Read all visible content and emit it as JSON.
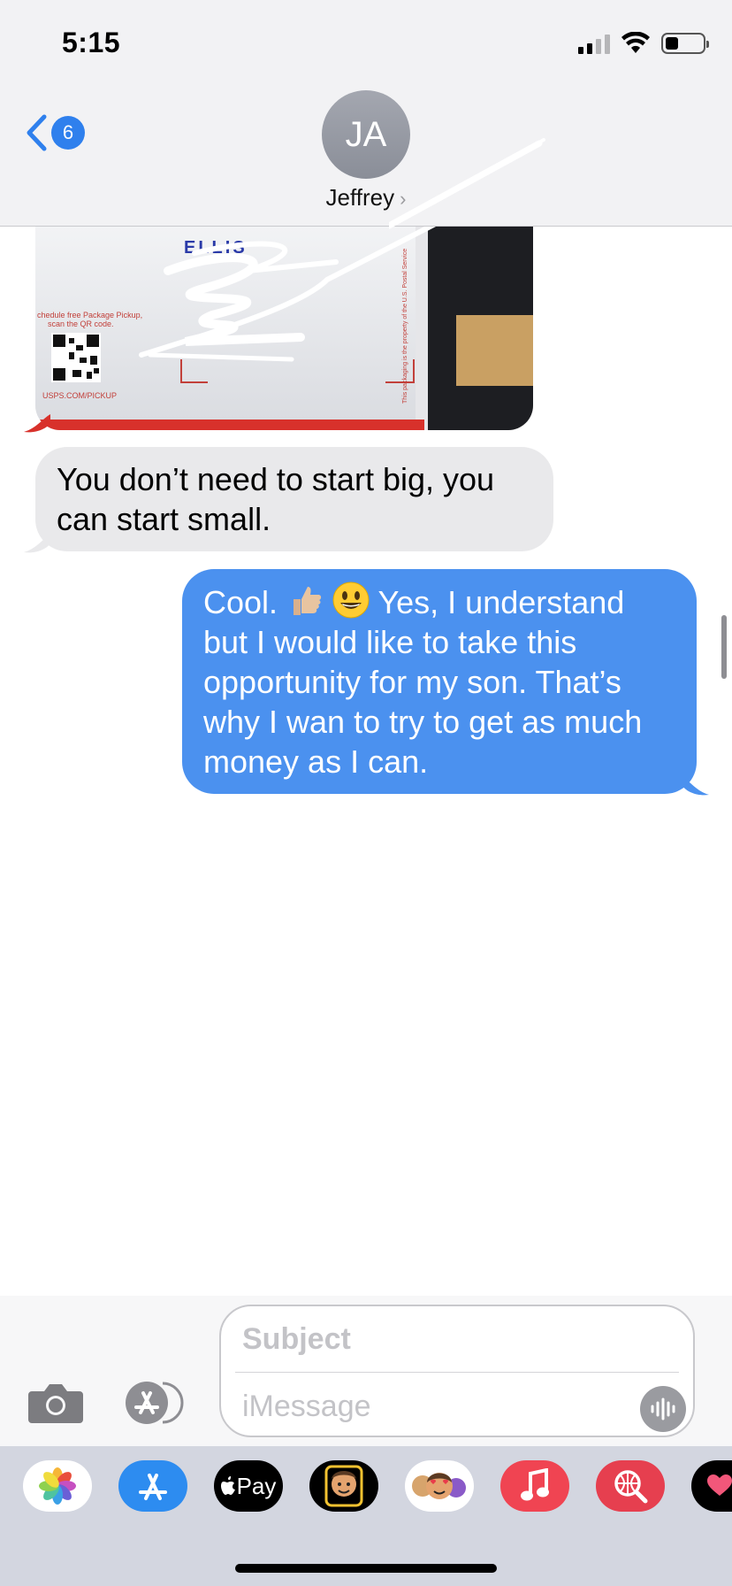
{
  "status_bar": {
    "time": "5:15"
  },
  "header": {
    "back_badge": "6",
    "avatar_initials": "JA",
    "contact_name": "Jeffrey",
    "chevron": "›"
  },
  "messages": [
    {
      "type": "image",
      "sender": "them",
      "image_text": {
        "name": "ELLIS",
        "schedule": "chedule free Package Pickup,",
        "scan": "scan the QR code.",
        "url": "USPS.COM/PICKUP",
        "side": "This packaging is the property of the U.S. Postal Service"
      }
    },
    {
      "type": "text",
      "sender": "them",
      "text": "You don’t need to start big, you can start small."
    },
    {
      "type": "text",
      "sender": "me",
      "text_before": "Cool.",
      "emojis": [
        "thumbs-up-icon",
        "grinning-face-icon"
      ],
      "text_after": "Yes, I understand but I would like to take this opportunity for my son. That’s why I wan to try to get as much money as I can."
    }
  ],
  "composer": {
    "subject_placeholder": "Subject",
    "message_placeholder": "iMessage"
  },
  "app_tray": [
    {
      "name": "photos",
      "icon": "photos-icon",
      "color": "#ffffff"
    },
    {
      "name": "app-store",
      "icon": "app-store-icon",
      "color": "#2d8cf0"
    },
    {
      "name": "apple-pay",
      "label": "Pay",
      "icon": "apple-icon",
      "color": "#000000"
    },
    {
      "name": "memoji-camera",
      "icon": "memoji-icon",
      "color": "#000000"
    },
    {
      "name": "memoji-stickers",
      "icon": "memoji-stickers-icon",
      "color": "#ffffff"
    },
    {
      "name": "music",
      "icon": "music-note-icon",
      "color": "#f04452"
    },
    {
      "name": "web-search",
      "icon": "globe-search-icon",
      "color": "#e63f4f"
    },
    {
      "name": "digital-touch",
      "icon": "heart-icon",
      "color": "#000000"
    }
  ],
  "colors": {
    "blue": "#4b91ef",
    "gray_bubble": "#e9e9eb",
    "badge": "#2f80ed"
  }
}
